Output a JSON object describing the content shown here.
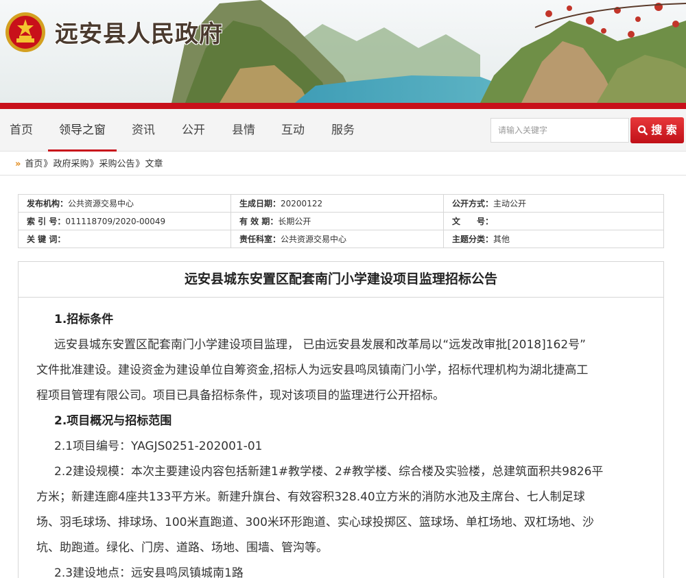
{
  "site": {
    "title": "远安县人民政府"
  },
  "nav": {
    "items": [
      {
        "label": "首页",
        "active": false
      },
      {
        "label": "领导之窗",
        "active": true
      },
      {
        "label": "资讯",
        "active": false
      },
      {
        "label": "公开",
        "active": false
      },
      {
        "label": "县情",
        "active": false
      },
      {
        "label": "互动",
        "active": false
      },
      {
        "label": "服务",
        "active": false
      }
    ],
    "search_placeholder": "请输入关键字",
    "search_label": "搜 索"
  },
  "breadcrumb": {
    "items": [
      "首页",
      "政府采购",
      "采购公告",
      "文章"
    ],
    "separator": "》"
  },
  "meta": {
    "rows": [
      [
        {
          "k": "发布机构：",
          "v": "公共资源交易中心"
        },
        {
          "k": "生成日期：",
          "v": "20200122"
        },
        {
          "k": "公开方式：",
          "v": "主动公开"
        }
      ],
      [
        {
          "k": "索 引 号：",
          "v": "011118709/2020-00049"
        },
        {
          "k": "有 效 期：",
          "v": "长期公开"
        },
        {
          "k": "文　　号：",
          "v": ""
        }
      ],
      [
        {
          "k": "关 键 词：",
          "v": ""
        },
        {
          "k": "责任科室：",
          "v": "公共资源交易中心"
        },
        {
          "k": "主题分类：",
          "v": "其他"
        }
      ]
    ]
  },
  "article": {
    "title": "远安县城东安置区配套南门小学建设项目监理招标公告",
    "h1": "1.招标条件",
    "p1a": "远安县城东安置区配套南门小学建设项目监理， 已由远安县发展和改革局以“远发改审批[2018]162号”",
    "p1b": "文件批准建设。建设资金为建设单位自筹资金,招标人为远安县鸣凤镇南门小学，招标代理机构为湖北捷高工",
    "p1c": "程项目管理有限公司。项目已具备招标条件，现对该项目的监理进行公开招标。",
    "h2": "2.项目概况与招标范围",
    "p21": "2.1项目编号：YAGJS0251-202001-01",
    "p22a": "2.2建设规模：本次主要建设内容包括新建1#教学楼、2#教学楼、综合楼及实验楼，总建筑面积共9826平",
    "p22b": "方米；新建连廊4座共133平方米。新建升旗台、有效容积328.40立方米的消防水池及主席台、七人制足球",
    "p22c": "场、羽毛球场、排球场、100米直跑道、300米环形跑道、实心球投掷区、篮球场、单杠场地、双杠场地、沙",
    "p22d": "坑、助跑道。绿化、门房、道路、场地、围墙、管沟等。",
    "p23": "2.3建设地点：远安县鸣凤镇城南1路"
  },
  "colors": {
    "brand_red": "#c8101a",
    "breadcrumb_arrow": "#e18a1a"
  },
  "icons": [
    "national-emblem-icon",
    "search-icon",
    "double-arrow-icon"
  ]
}
